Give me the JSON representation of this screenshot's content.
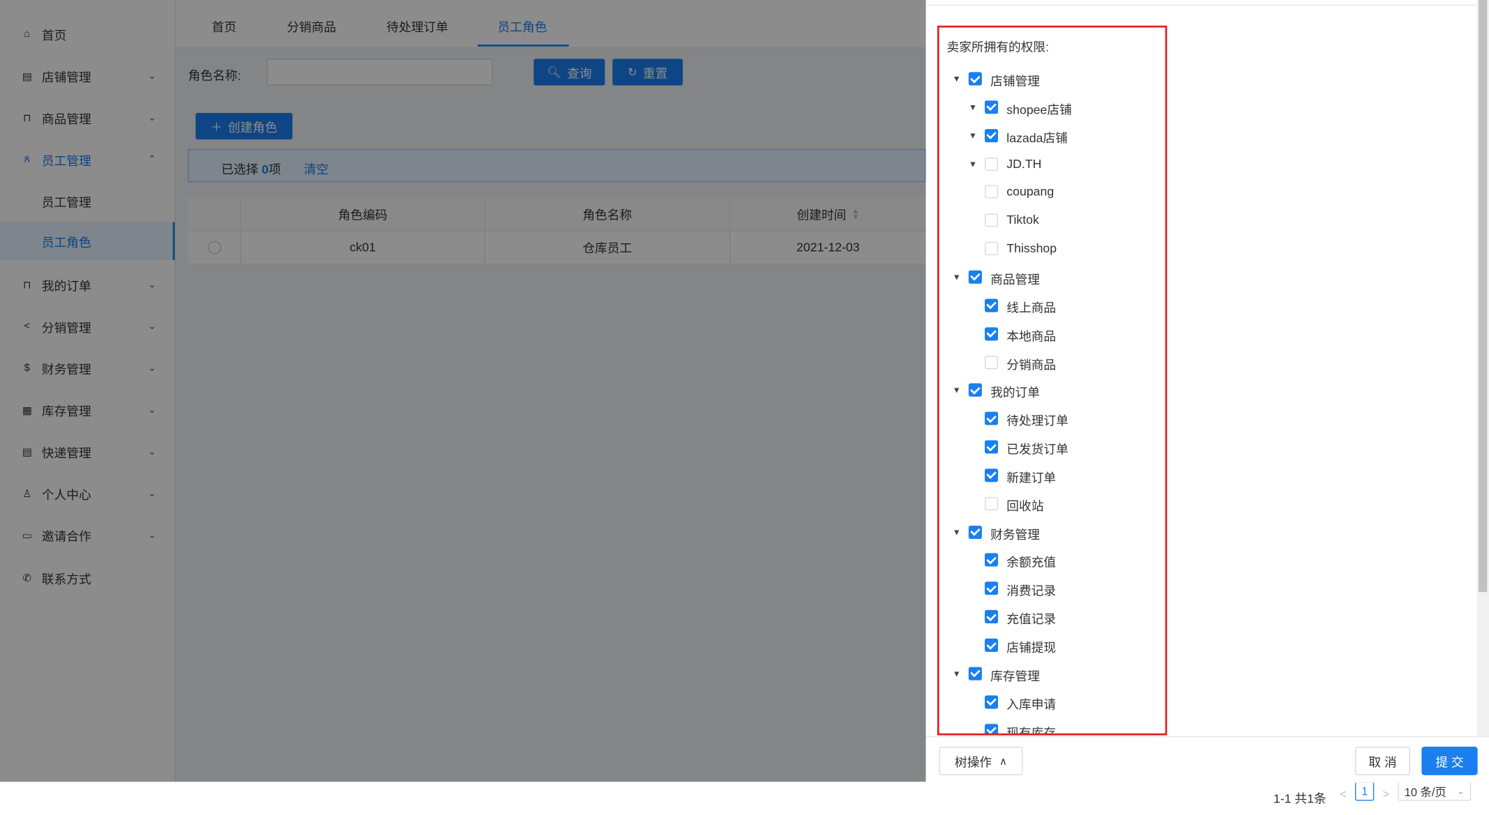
{
  "sidebar": {
    "items": [
      {
        "label": "首页",
        "icon": "home-icon"
      },
      {
        "label": "店铺管理",
        "icon": "store-icon"
      },
      {
        "label": "商品管理",
        "icon": "bag-icon"
      },
      {
        "label": "员工管理",
        "icon": "staff-icon"
      },
      {
        "label": "员工管理"
      },
      {
        "label": "员工角色"
      },
      {
        "label": "我的订单",
        "icon": "order-icon"
      },
      {
        "label": "分销管理",
        "icon": "share-icon"
      },
      {
        "label": "财务管理",
        "icon": "dollar-icon"
      },
      {
        "label": "库存管理",
        "icon": "grid-icon"
      },
      {
        "label": "快递管理",
        "icon": "list-icon"
      },
      {
        "label": "个人中心",
        "icon": "user-icon"
      },
      {
        "label": "邀请合作",
        "icon": "laptop-icon"
      },
      {
        "label": "联系方式",
        "icon": "phone-icon"
      }
    ]
  },
  "tabs": [
    "首页",
    "分销商品",
    "待处理订单",
    "员工角色"
  ],
  "search": {
    "label": "角色名称:",
    "placeholder": "",
    "query_label": "查询",
    "reset_label": "重置"
  },
  "create_label": "创建角色",
  "selection": {
    "prefix": "已选择",
    "count": "0",
    "suffix": "项",
    "clear_label": "清空"
  },
  "table": {
    "headers": [
      "角色编码",
      "角色名称",
      "创建时间"
    ],
    "rows": [
      {
        "code": "ck01",
        "name": "仓库员工",
        "created": "2021-12-03"
      }
    ]
  },
  "pagination": {
    "total": "1-1 共1条",
    "current": "1",
    "size": "10 条/页"
  },
  "drawer": {
    "title": "卖家所拥有的权限:",
    "tree_label": "树操作",
    "cancel_label": "取 消",
    "submit_label": "提 交",
    "tree": [
      {
        "label": "店铺管理",
        "level": 0,
        "checked": true,
        "caret": true
      },
      {
        "label": "shopee店铺",
        "level": 1,
        "checked": true,
        "caret": true
      },
      {
        "label": "lazada店铺",
        "level": 1,
        "checked": true,
        "caret": true
      },
      {
        "label": "JD.TH",
        "level": 1,
        "checked": false,
        "caret": true
      },
      {
        "label": "coupang",
        "level": 1,
        "checked": false,
        "caret": false
      },
      {
        "label": "Tiktok",
        "level": 1,
        "checked": false,
        "caret": false
      },
      {
        "label": "Thisshop",
        "level": 1,
        "checked": false,
        "caret": false
      },
      {
        "label": "商品管理",
        "level": 0,
        "checked": true,
        "caret": true
      },
      {
        "label": "线上商品",
        "level": 1,
        "checked": true,
        "caret": false
      },
      {
        "label": "本地商品",
        "level": 1,
        "checked": true,
        "caret": false
      },
      {
        "label": "分销商品",
        "level": 1,
        "checked": false,
        "caret": false
      },
      {
        "label": "我的订单",
        "level": 0,
        "checked": true,
        "caret": true
      },
      {
        "label": "待处理订单",
        "level": 1,
        "checked": true,
        "caret": false
      },
      {
        "label": "已发货订单",
        "level": 1,
        "checked": true,
        "caret": false
      },
      {
        "label": "新建订单",
        "level": 1,
        "checked": true,
        "caret": false
      },
      {
        "label": "回收站",
        "level": 1,
        "checked": false,
        "caret": false
      },
      {
        "label": "财务管理",
        "level": 0,
        "checked": true,
        "caret": true
      },
      {
        "label": "余额充值",
        "level": 1,
        "checked": true,
        "caret": false
      },
      {
        "label": "消费记录",
        "level": 1,
        "checked": true,
        "caret": false
      },
      {
        "label": "充值记录",
        "level": 1,
        "checked": true,
        "caret": false
      },
      {
        "label": "店铺提现",
        "level": 1,
        "checked": true,
        "caret": false
      },
      {
        "label": "库存管理",
        "level": 0,
        "checked": true,
        "caret": true
      },
      {
        "label": "入库申请",
        "level": 1,
        "checked": true,
        "caret": false
      },
      {
        "label": "现有库存",
        "level": 1,
        "checked": true,
        "caret": false
      }
    ]
  },
  "colors": {
    "accent": "#1a7ff0",
    "highlight_border": "#e02020"
  }
}
